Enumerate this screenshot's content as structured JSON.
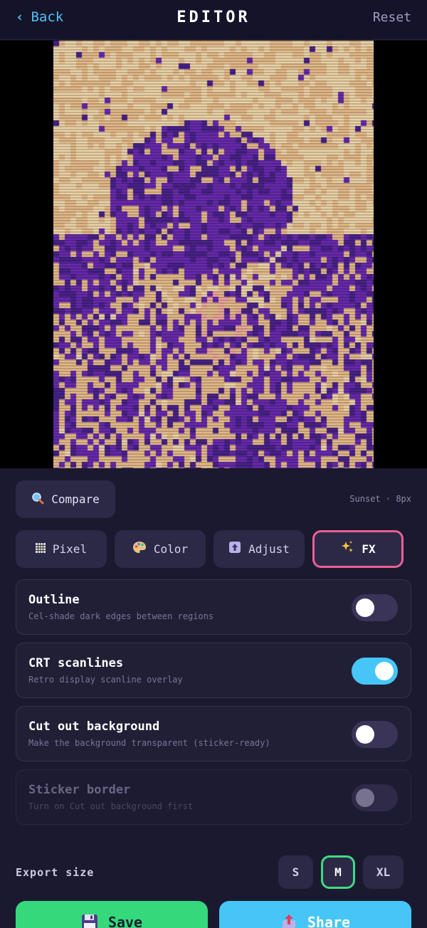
{
  "header": {
    "back_label": "Back",
    "title": "EDITOR",
    "reset_label": "Reset"
  },
  "preview": {
    "palette": [
      "#f1d8ac",
      "#e8bd8c",
      "#6a2bb0",
      "#4b238c",
      "#f0aa9c"
    ]
  },
  "toolbar": {
    "compare_label": "Compare",
    "compare_icon": "magnifier-icon",
    "meta": "Sunset · 8px"
  },
  "tabs": [
    {
      "label": "Pixel",
      "icon": "grid-icon"
    },
    {
      "label": "Color",
      "icon": "palette-icon"
    },
    {
      "label": "Adjust",
      "icon": "upload-arrow-icon"
    },
    {
      "label": "FX",
      "icon": "sparkles-icon"
    }
  ],
  "active_tab": "FX",
  "options": [
    {
      "title": "Outline",
      "desc": "Cel-shade dark edges between regions",
      "on": false
    },
    {
      "title": "CRT scanlines",
      "desc": "Retro display scanline overlay",
      "on": true
    },
    {
      "title": "Cut out background",
      "desc": "Make the background transparent (sticker-ready)",
      "on": false
    },
    {
      "title": "Sticker border",
      "desc": "Turn on Cut out background first",
      "on": false,
      "disabled": true
    }
  ],
  "export": {
    "label": "Export size",
    "sizes": [
      "S",
      "M",
      "XL"
    ],
    "selected": "M"
  },
  "actions": {
    "save_label": "Save",
    "share_label": "Share"
  },
  "colors": {
    "accent_blue": "#45c6f7",
    "accent_green": "#35d97c",
    "accent_pink": "#ec5f93"
  }
}
